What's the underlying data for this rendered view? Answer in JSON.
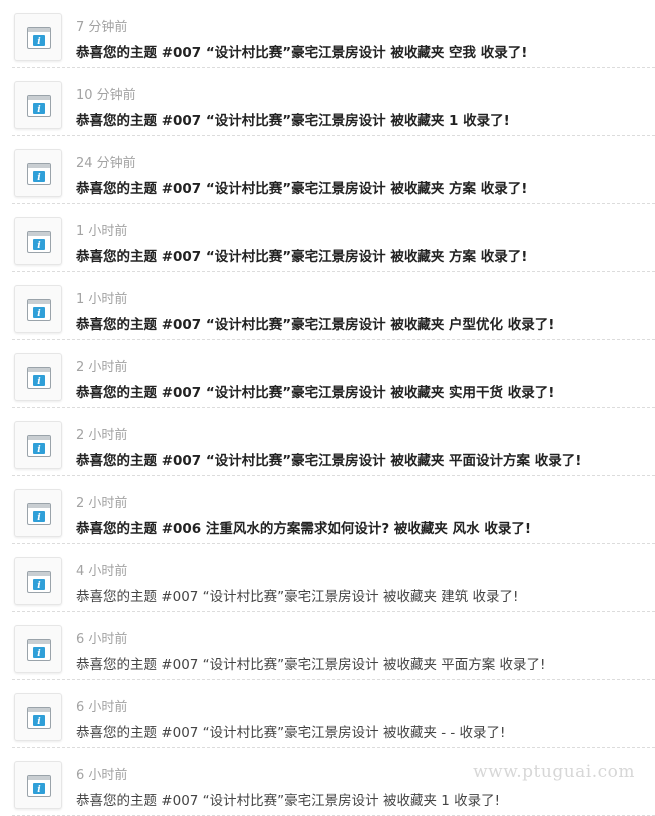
{
  "watermark": "www.ptuguai.com",
  "notifications": [
    {
      "time": "7 分钟前",
      "message": "恭喜您的主题 #007 “设计村比赛”豪宅江景房设计 被收藏夹 空我 收录了!",
      "unread": true
    },
    {
      "time": "10 分钟前",
      "message": "恭喜您的主题 #007 “设计村比赛”豪宅江景房设计 被收藏夹 1 收录了!",
      "unread": true
    },
    {
      "time": "24 分钟前",
      "message": "恭喜您的主题 #007 “设计村比赛”豪宅江景房设计 被收藏夹 方案 收录了!",
      "unread": true
    },
    {
      "time": "1 小时前",
      "message": "恭喜您的主题 #007 “设计村比赛”豪宅江景房设计 被收藏夹 方案 收录了!",
      "unread": true
    },
    {
      "time": "1 小时前",
      "message": "恭喜您的主题 #007 “设计村比赛”豪宅江景房设计 被收藏夹 户型优化 收录了!",
      "unread": true
    },
    {
      "time": "2 小时前",
      "message": "恭喜您的主题 #007 “设计村比赛”豪宅江景房设计 被收藏夹 实用干货 收录了!",
      "unread": true
    },
    {
      "time": "2 小时前",
      "message": "恭喜您的主题 #007 “设计村比赛”豪宅江景房设计 被收藏夹 平面设计方案 收录了!",
      "unread": true
    },
    {
      "time": "2 小时前",
      "message": "恭喜您的主题 #006 注重风水的方案需求如何设计? 被收藏夹 风水 收录了!",
      "unread": true
    },
    {
      "time": "4 小时前",
      "message": "恭喜您的主题 #007 “设计村比赛”豪宅江景房设计 被收藏夹 建筑 收录了!",
      "unread": false
    },
    {
      "time": "6 小时前",
      "message": "恭喜您的主题 #007 “设计村比赛”豪宅江景房设计 被收藏夹 平面方案 收录了!",
      "unread": false
    },
    {
      "time": "6 小时前",
      "message": "恭喜您的主题 #007 “设计村比赛”豪宅江景房设计 被收藏夹 - - 收录了!",
      "unread": false
    },
    {
      "time": "6 小时前",
      "message": "恭喜您的主题 #007 “设计村比赛”豪宅江景房设计 被收藏夹 1 收录了!",
      "unread": false
    }
  ]
}
